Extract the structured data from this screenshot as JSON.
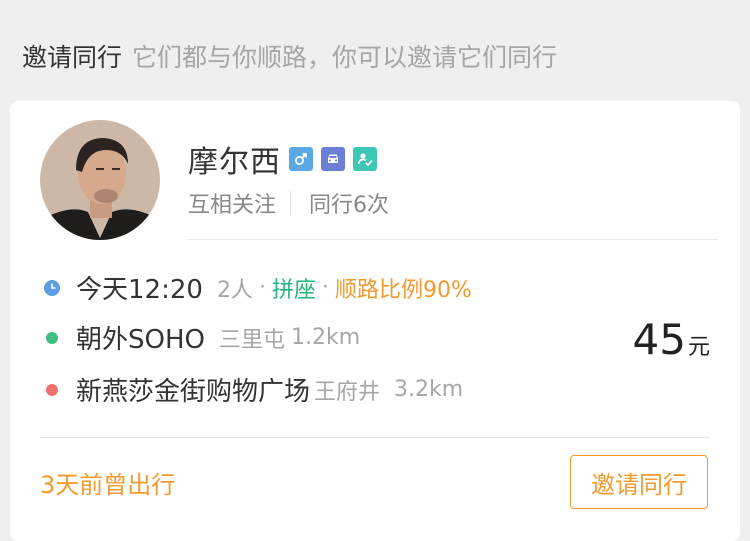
{
  "header": {
    "title": "邀请同行",
    "subtitle": "它们都与你顺路，你可以邀请它们同行"
  },
  "card": {
    "user": {
      "name": "摩尔西",
      "badges": [
        {
          "icon": "male-icon",
          "color": "#5aa9e6"
        },
        {
          "icon": "car-icon",
          "color": "#6b7fd7"
        },
        {
          "icon": "verified-user-icon",
          "color": "#3cc8b4"
        }
      ],
      "mutual_follow": "互相关注",
      "trips_together": "同行6次"
    },
    "trip": {
      "time": "今天12:20",
      "people": "2人",
      "separator": "·",
      "ride_type": "拼座",
      "route_match": "顺路比例90%",
      "origin": {
        "name": "朝外SOHO",
        "area": "三里屯",
        "distance": "1.2km"
      },
      "destination": {
        "name": "新燕莎金街购物广场",
        "area": "王府井",
        "distance": "3.2km"
      }
    },
    "price": {
      "amount": "45",
      "unit": "元"
    },
    "past_trip": "3天前曾出行",
    "invite_button": "邀请同行"
  },
  "colors": {
    "orange": "#f29a2e",
    "green": "#27b37a",
    "time_dot": "#5b9ee6",
    "origin_dot": "#3fbf82",
    "destination_dot": "#f07070"
  }
}
